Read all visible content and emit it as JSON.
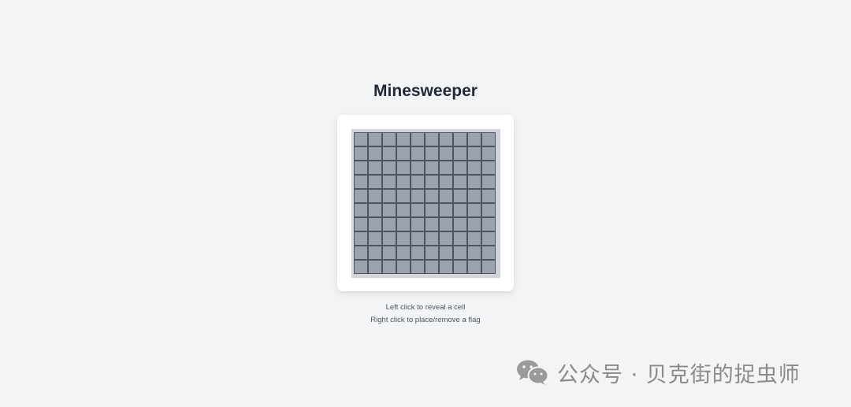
{
  "game": {
    "title": "Minesweeper",
    "rows": 10,
    "cols": 10,
    "cell_state": "hidden"
  },
  "instructions": {
    "line1": "Left click to reveal a cell",
    "line2": "Right click to place/remove a flag"
  },
  "watermark": {
    "text": "公众号 · 贝克街的捉虫师",
    "icon": "wechat-icon"
  },
  "colors": {
    "background": "#f3f4f6",
    "card": "#ffffff",
    "board": "#d1d5db",
    "cell_fill": "#9ca3af",
    "cell_border": "#4b5563",
    "title": "#1f2937"
  }
}
